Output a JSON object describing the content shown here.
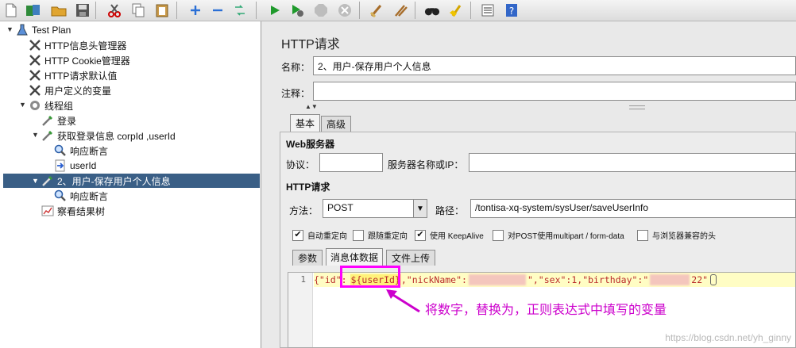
{
  "tree": {
    "items": [
      {
        "label": "Test Plan",
        "icon": "flask-icon"
      },
      {
        "label": "HTTP信息头管理器",
        "icon": "wrench-icon"
      },
      {
        "label": "HTTP Cookie管理器",
        "icon": "wrench-icon"
      },
      {
        "label": "HTTP请求默认值",
        "icon": "wrench-icon"
      },
      {
        "label": "用户定义的变量",
        "icon": "wrench-icon"
      },
      {
        "label": "线程组",
        "icon": "gear-icon"
      },
      {
        "label": "登录",
        "icon": "pipette-icon"
      },
      {
        "label": "获取登录信息 corpId ,userId",
        "icon": "pipette-icon"
      },
      {
        "label": "响应断言",
        "icon": "magnifier-icon"
      },
      {
        "label": "userId",
        "icon": "extractor-icon"
      },
      {
        "label": "2、用户-保存用户个人信息",
        "icon": "pipette-icon"
      },
      {
        "label": "响应断言",
        "icon": "magnifier-icon"
      },
      {
        "label": "察看结果树",
        "icon": "chart-icon"
      }
    ]
  },
  "panel": {
    "title": "HTTP请求",
    "name_label": "名称：",
    "name_value": "2、用户-保存用户个人信息",
    "comment_label": "注释：",
    "comment_value": "",
    "tabs": [
      "基本",
      "高级"
    ],
    "web_server_section": "Web服务器",
    "protocol_label": "协议：",
    "protocol_value": "",
    "server_label": "服务器名称或IP：",
    "server_value": "",
    "http_request_section": "HTTP请求",
    "method_label": "方法：",
    "method_value": "POST",
    "path_label": "路径：",
    "path_value": "/tontisa-xq-system/sysUser/saveUserInfo",
    "checkboxes": [
      {
        "label": "自动重定向",
        "checked": true
      },
      {
        "label": "跟随重定向",
        "checked": false
      },
      {
        "label": "使用 KeepAlive",
        "checked": true
      },
      {
        "label": "对POST使用multipart / form-data",
        "checked": false
      },
      {
        "label": "与浏览器兼容的头",
        "checked": false
      }
    ],
    "body_tabs": [
      "参数",
      "消息体数据",
      "文件上传"
    ],
    "editor": {
      "line_number": "1",
      "code_part1": "{\"id\":",
      "code_var": "${userId}",
      "code_part2": ",\"nickName\":",
      "code_part3": "\",\"sex\":1,\"birthday\":\"",
      "code_part4": "22\""
    }
  },
  "annotation": {
    "text": "将数字，替换为，正则表达式中填写的变量",
    "color": "#cc00cc"
  },
  "watermark": "https://blog.csdn.net/yh_ginny"
}
